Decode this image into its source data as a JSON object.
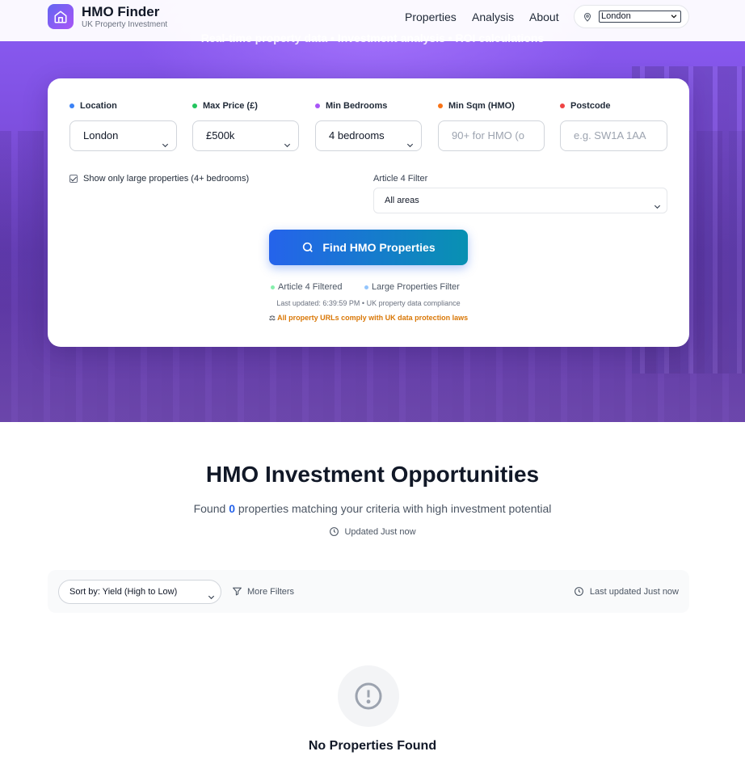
{
  "header": {
    "brand_title": "HMO Finder",
    "brand_subtitle": "UK Property Investment",
    "nav": [
      "Properties",
      "Analysis",
      "About"
    ],
    "location_value": "London"
  },
  "hero": {
    "tagline": "Real-time property data • Investment analysis • ROI calculations"
  },
  "search": {
    "fields": [
      {
        "label": "Location",
        "value": "London",
        "kind": "select",
        "dot_color": "#3b82f6"
      },
      {
        "label": "Max Price (£)",
        "value": "£500k",
        "kind": "select",
        "dot_color": "#22c55e"
      },
      {
        "label": "Min Bedrooms",
        "value": "4 bedrooms",
        "kind": "select",
        "dot_color": "#a855f7"
      },
      {
        "label": "Min Sqm (HMO)",
        "placeholder": "90+ for HMO (o",
        "kind": "input",
        "dot_color": "#f97316"
      },
      {
        "label": "Postcode",
        "placeholder": "e.g. SW1A 1AA",
        "kind": "input",
        "dot_color": "#ef4444"
      }
    ],
    "large_only_label": "Show only large properties (4+ bedrooms)",
    "large_only_checked": true,
    "article4_label": "Article 4 Filter",
    "article4_value": "All areas",
    "find_button": "Find HMO Properties",
    "legend": [
      {
        "label": "Article 4 Filtered",
        "color": "#86efac"
      },
      {
        "label": "Large Properties Filter",
        "color": "#93c5fd"
      }
    ],
    "last_updated": "Last updated: 6:39:59 PM • UK property data compliance",
    "compliance": "All property URLs comply with UK data protection laws"
  },
  "results": {
    "title": "HMO Investment Opportunities",
    "sub_prefix": "Found",
    "count": "0",
    "sub_suffix": "properties matching your criteria with high investment potential",
    "updated": "Updated Just now",
    "sort_value": "Sort by: Yield (High to Low)",
    "more_filters": "More Filters",
    "toolbar_updated": "Last updated Just now",
    "empty_title": "No Properties Found"
  }
}
